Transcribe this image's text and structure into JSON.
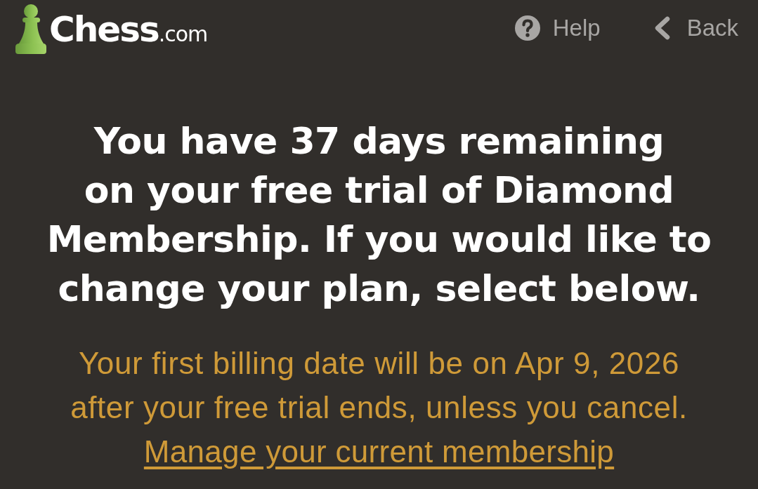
{
  "header": {
    "logo": {
      "brand": "Chess",
      "domain": ".com"
    },
    "nav": [
      {
        "kind": "help",
        "label": "Help"
      },
      {
        "kind": "back",
        "label": "Back"
      }
    ]
  },
  "trial": {
    "heading": "You have 37 days remaining on your free trial of Diamond Membership. If you would like to change your plan, select below.",
    "billing_note": "Your first billing date will be on Apr 9, 2026 after your free trial ends, unless you cancel.",
    "manage_link": "Manage your current membership"
  }
}
